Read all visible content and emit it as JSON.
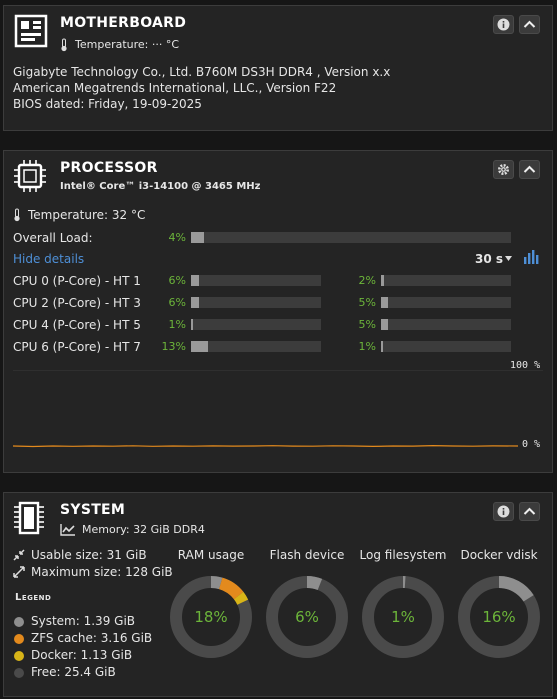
{
  "motherboard": {
    "title": "MOTHERBOARD",
    "temperature": "Temperature: ··· °C",
    "line1": "Gigabyte Technology Co., Ltd. B760M DS3H DDR4 , Version x.x",
    "line2": "American Megatrends International, LLC., Version F22",
    "line3": "BIOS dated: Friday, 19-09-2025"
  },
  "processor": {
    "title": "PROCESSOR",
    "model": "Intel® Core™ i3-14100 @ 3465 MHz",
    "temperature": "Temperature: 32 °C",
    "overall_label": "Overall Load:",
    "overall_pct": "4%",
    "overall_value": 0.04,
    "hide_details": "Hide details",
    "interval": "30 s",
    "cores": [
      {
        "label": "CPU 0 (P-Core) - HT 1",
        "a": "6%",
        "a_value": 0.06,
        "b": "2%",
        "b_value": 0.02
      },
      {
        "label": "CPU 2 (P-Core) - HT 3",
        "a": "6%",
        "a_value": 0.06,
        "b": "5%",
        "b_value": 0.05
      },
      {
        "label": "CPU 4 (P-Core) - HT 5",
        "a": "1%",
        "a_value": 0.01,
        "b": "5%",
        "b_value": 0.05
      },
      {
        "label": "CPU 6 (P-Core) - HT 7",
        "a": "13%",
        "a_value": 0.13,
        "b": "1%",
        "b_value": 0.01
      }
    ],
    "chart_max": "100 %",
    "chart_min": "0 %"
  },
  "system": {
    "title": "SYSTEM",
    "memory": "Memory: 32 GiB DDR4",
    "usable": "Usable size: 31 GiB",
    "maximum": "Maximum size: 128 GiB",
    "legend_title": "Legend",
    "legend": [
      {
        "label": "System: 1.39 GiB",
        "color": "#8e8e8e"
      },
      {
        "label": "ZFS cache: 3.16 GiB",
        "color": "#e38a1d"
      },
      {
        "label": "Docker: 1.13 GiB",
        "color": "#d8b418"
      },
      {
        "label": "Free: 25.4 GiB",
        "color": "#4a4a4a"
      }
    ],
    "gauges": [
      {
        "label": "RAM usage",
        "pct": "18%",
        "value": 0.18
      },
      {
        "label": "Flash device",
        "pct": "6%",
        "value": 0.06
      },
      {
        "label": "Log filesystem",
        "pct": "1%",
        "value": 0.01
      },
      {
        "label": "Docker vdisk",
        "pct": "16%",
        "value": 0.16
      }
    ]
  },
  "colors": {
    "accent_green": "#6cb53a",
    "link_blue": "#4e8fd6",
    "chart_line": "#e38a1d"
  }
}
